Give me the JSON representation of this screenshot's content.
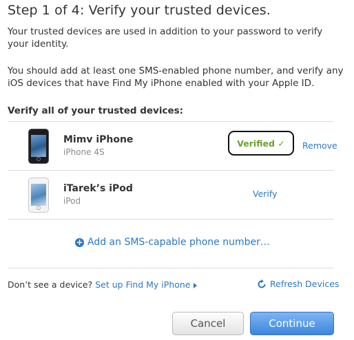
{
  "header": {
    "title": "Step 1 of 4: Verify your trusted devices."
  },
  "intro": {
    "paragraph1": "Your trusted devices are used in addition to your password to verify your identity.",
    "paragraph2": "You should add at least one SMS-enabled phone number, and verify any iOS devices that have Find My iPhone enabled with your Apple ID."
  },
  "devices_section": {
    "heading": "Verify all of your trusted devices:",
    "devices": [
      {
        "name": "Mimv iPhone",
        "model": "iPhone 4S",
        "icon": "iphone-icon",
        "status": "Verified ✓",
        "action": "Remove"
      },
      {
        "name": "iTarek’s iPod",
        "model": "iPod",
        "icon": "ipod-icon",
        "action": "Verify"
      }
    ],
    "add_label": "Add an SMS-capable phone number…"
  },
  "footer": {
    "prompt": "Don’t see a device?",
    "setup_link": "Set up Find My iPhone",
    "refresh_label": "Refresh Devices"
  },
  "buttons": {
    "cancel": "Cancel",
    "continue": "Continue"
  },
  "colors": {
    "link": "#2a78c5",
    "verified": "#6aa12a",
    "primary_button": "#3c86de"
  }
}
